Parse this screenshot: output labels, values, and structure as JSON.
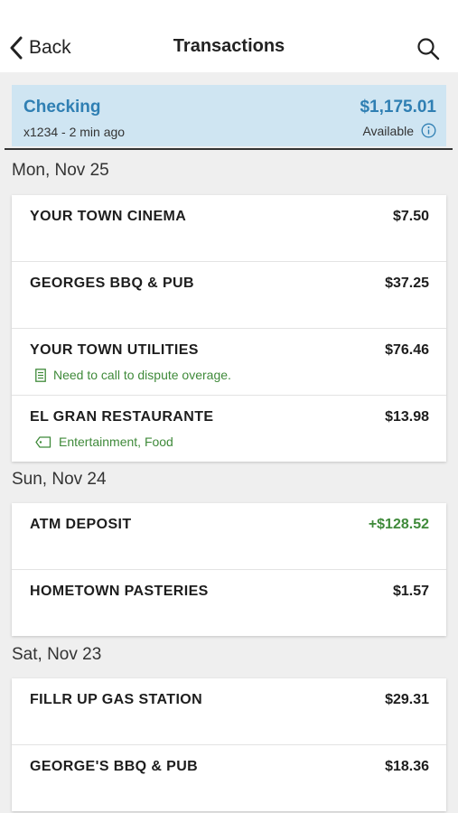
{
  "nav": {
    "back_label": "Back",
    "title": "Transactions",
    "search_icon": "search-icon",
    "back_icon": "chevron-left-icon"
  },
  "account": {
    "name": "Checking",
    "subtitle": "x1234 - 2 min ago",
    "balance": "$1,175.01",
    "balance_label": "Available",
    "info_icon": "info-icon"
  },
  "colors": {
    "accent": "#2f7fb3",
    "account_bg": "#cfe5f2",
    "credit": "#3f8a3a",
    "background": "#efefef"
  },
  "groups": [
    {
      "date": "Mon, Nov 25",
      "items": [
        {
          "merchant": "YOUR TOWN CINEMA",
          "amount": "$7.50"
        },
        {
          "merchant": "GEORGES BBQ & PUB",
          "amount": "$37.25"
        },
        {
          "merchant": "YOUR TOWN UTILITIES",
          "amount": "$76.46",
          "note": "Need to call to dispute overage.",
          "note_icon": "note-icon"
        },
        {
          "merchant": "EL GRAN RESTAURANTE",
          "amount": "$13.98",
          "tags": "Entertainment, Food",
          "tags_icon": "tag-icon"
        }
      ]
    },
    {
      "date": "Sun, Nov 24",
      "items": [
        {
          "merchant": "ATM DEPOSIT",
          "amount": "+$128.52",
          "credit": true
        },
        {
          "merchant": "HOMETOWN PASTERIES",
          "amount": "$1.57"
        }
      ]
    },
    {
      "date": "Sat, Nov 23",
      "items": [
        {
          "merchant": "FILLR UP GAS STATION",
          "amount": "$29.31"
        },
        {
          "merchant": "GEORGE'S BBQ & PUB",
          "amount": "$18.36"
        }
      ]
    }
  ]
}
